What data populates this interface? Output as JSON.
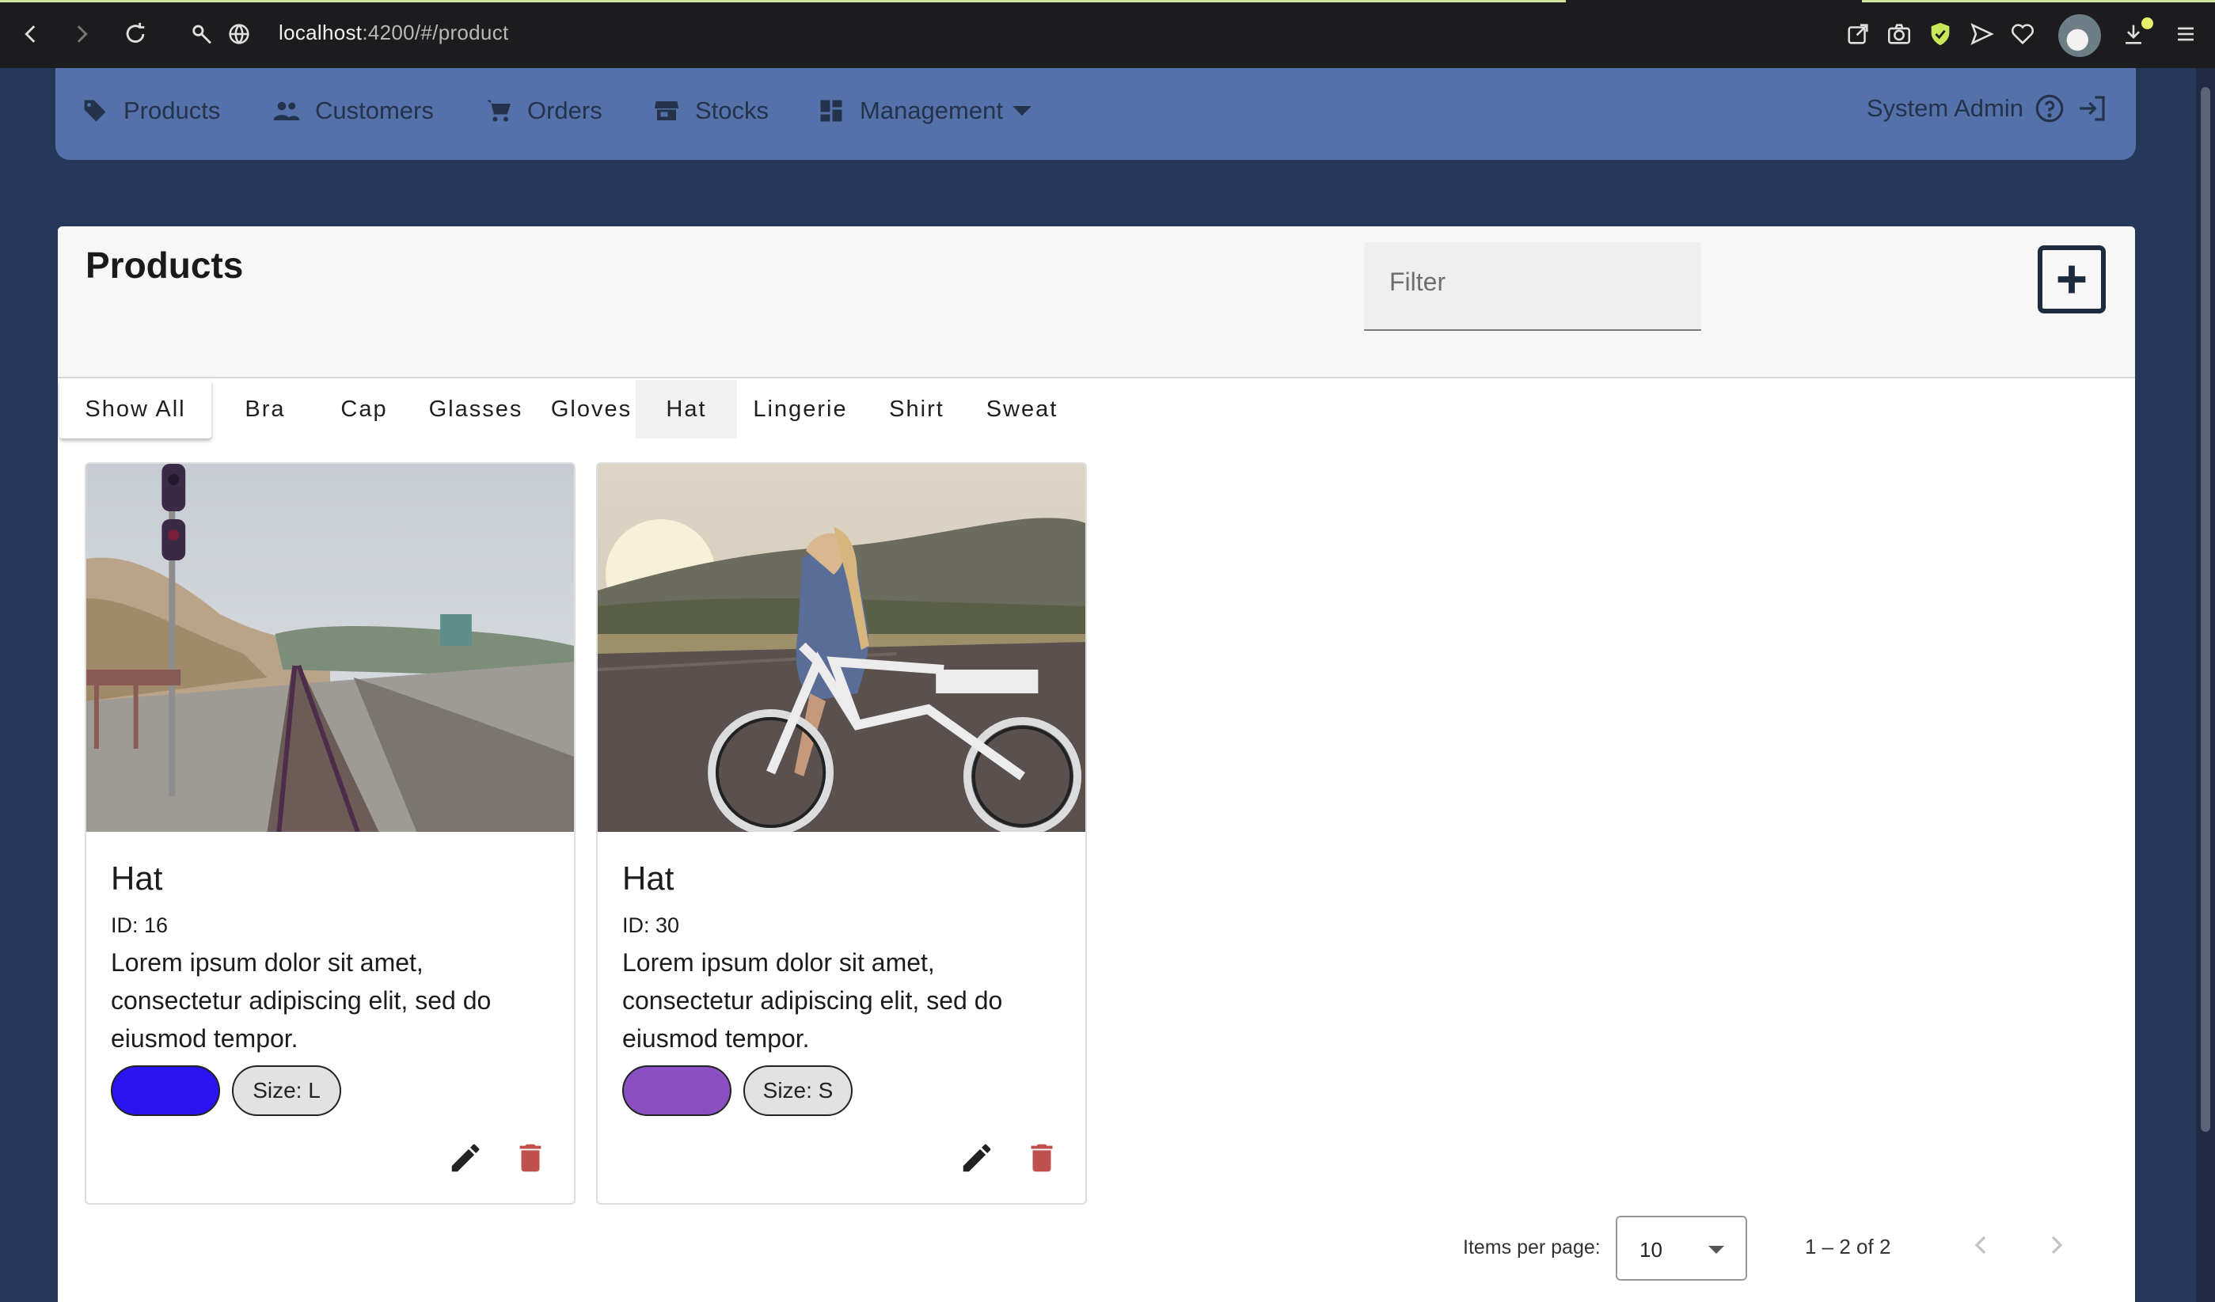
{
  "browser": {
    "url_host": "localhost",
    "url_path": ":4200/#/product"
  },
  "nav": {
    "items": [
      {
        "label": "Products",
        "icon": "tag-icon"
      },
      {
        "label": "Customers",
        "icon": "people-icon"
      },
      {
        "label": "Orders",
        "icon": "cart-icon"
      },
      {
        "label": "Stocks",
        "icon": "store-icon"
      },
      {
        "label": "Management",
        "icon": "dashboard-icon"
      }
    ],
    "user": "System Admin"
  },
  "page": {
    "title": "Products",
    "filter_placeholder": "Filter"
  },
  "tabs": [
    "Show All",
    "Bra",
    "Cap",
    "Glasses",
    "Gloves",
    "Hat",
    "Lingerie",
    "Shirt",
    "Sweat"
  ],
  "products": [
    {
      "name": "Hat",
      "id": "ID: 16",
      "description": "Lorem ipsum dolor sit amet, consectetur adipiscing elit, sed do eiusmod tempor.",
      "color": "#2a15f0",
      "size": "Size: L",
      "image": "railway-coast-photo"
    },
    {
      "name": "Hat",
      "id": "ID: 30",
      "description": "Lorem ipsum dolor sit amet, consectetur adipiscing elit, sed do eiusmod tempor.",
      "color": "#8a4fc0",
      "size": "Size: S",
      "image": "woman-bicycle-photo"
    }
  ],
  "paginator": {
    "label": "Items per page:",
    "page_size": "10",
    "range": "1 – 2 of 2"
  },
  "colors": {
    "background": "#263859",
    "toolbar": "#5471aa",
    "delete": "#c0504d"
  }
}
